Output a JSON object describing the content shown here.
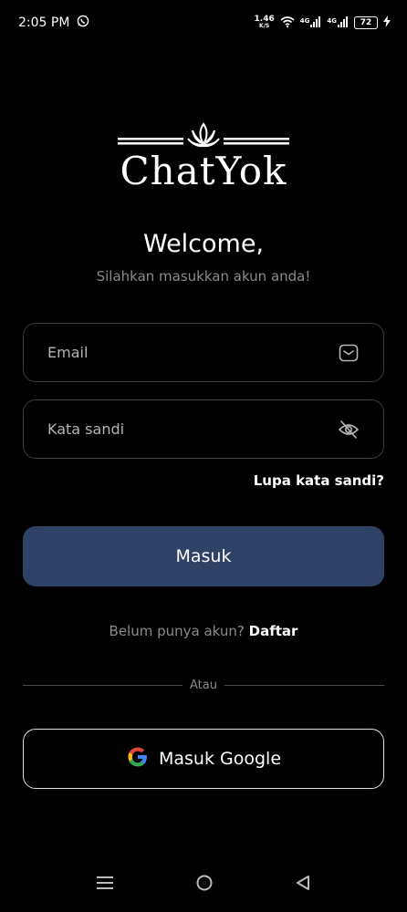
{
  "status_bar": {
    "time": "2:05 PM",
    "speed_value": "1.46",
    "speed_unit": "K/S",
    "network1": "4G",
    "network2": "4G",
    "battery": "72"
  },
  "logo": {
    "text": "ChatYok"
  },
  "welcome": {
    "title": "Welcome,",
    "subtitle": "Silahkan masukkan akun anda!"
  },
  "form": {
    "email_placeholder": "Email",
    "password_placeholder": "Kata sandi",
    "forgot_label": "Lupa kata sandi?",
    "login_label": "Masuk"
  },
  "signup": {
    "question": "Belum punya akun?",
    "link": "Daftar"
  },
  "divider": {
    "text": "Atau"
  },
  "google": {
    "label": "Masuk Google"
  },
  "colors": {
    "background": "#000000",
    "primary_button": "#2e4266",
    "muted_text": "#8a8a8a"
  },
  "icons": {
    "email": "mail-icon",
    "password": "eye-off-icon",
    "google": "google-icon",
    "nav_menu": "menu-icon",
    "nav_home": "home-icon",
    "nav_back": "back-icon"
  }
}
